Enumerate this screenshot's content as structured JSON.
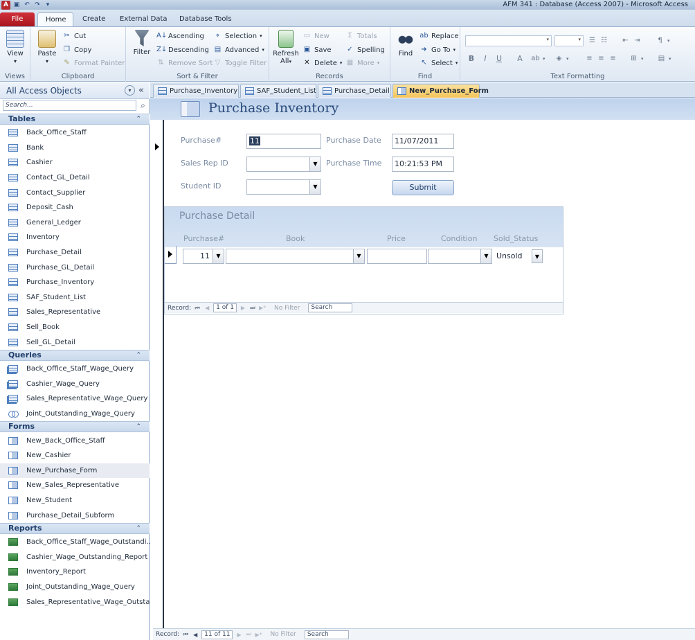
{
  "window": {
    "title": "AFM 341 : Database (Access 2007)  -  Microsoft Access",
    "app_logo": "A"
  },
  "quick_access": [
    "save-icon",
    "undo-icon",
    "redo-icon",
    "customize-icon"
  ],
  "ribbon": {
    "tabs": [
      "File",
      "Home",
      "Create",
      "External Data",
      "Database Tools"
    ],
    "active_tab": "Home",
    "groups": {
      "views": {
        "label": "Views",
        "view": "View"
      },
      "clipboard": {
        "label": "Clipboard",
        "paste": "Paste",
        "cut": "Cut",
        "copy": "Copy",
        "format_painter": "Format Painter"
      },
      "sort_filter": {
        "label": "Sort & Filter",
        "filter": "Filter",
        "ascending": "Ascending",
        "descending": "Descending",
        "remove_sort": "Remove Sort",
        "selection": "Selection",
        "advanced": "Advanced",
        "toggle_filter": "Toggle Filter"
      },
      "records": {
        "label": "Records",
        "refresh": "Refresh",
        "refresh2": "All",
        "new": "New",
        "save": "Save",
        "delete": "Delete",
        "totals": "Totals",
        "spelling": "Spelling",
        "more": "More"
      },
      "find": {
        "label": "Find",
        "find": "Find",
        "replace": "Replace",
        "goto": "Go To",
        "select": "Select"
      },
      "text_formatting": {
        "label": "Text Formatting",
        "bold": "B",
        "italic": "I",
        "underline": "U",
        "font_color": "A"
      }
    }
  },
  "nav": {
    "title": "All Access Objects",
    "search_placeholder": "Search...",
    "sections": [
      {
        "name": "Tables",
        "type": "table",
        "items": [
          "Back_Office_Staff",
          "Bank",
          "Cashier",
          "Contact_GL_Detail",
          "Contact_Supplier",
          "Deposit_Cash",
          "General_Ledger",
          "Inventory",
          "Purchase_Detail",
          "Purchase_GL_Detail",
          "Purchase_Inventory",
          "SAF_Student_List",
          "Sales_Representative",
          "Sell_Book",
          "Sell_GL_Detail"
        ]
      },
      {
        "name": "Queries",
        "type": "query",
        "items": [
          "Back_Office_Staff_Wage_Query",
          "Cashier_Wage_Query",
          "Sales_Representative_Wage_Query",
          "Joint_Outstanding_Wage_Query"
        ]
      },
      {
        "name": "Forms",
        "type": "form",
        "items": [
          "New_Back_Office_Staff",
          "New_Cashier",
          "New_Purchase_Form",
          "New_Sales_Representative",
          "New_Student",
          "Purchase_Detail_Subform"
        ],
        "selected": "New_Purchase_Form"
      },
      {
        "name": "Reports",
        "type": "report",
        "items": [
          "Back_Office_Staff_Wage_Outstandi...",
          "Cashier_Wage_Outstanding_Report",
          "Inventory_Report",
          "Joint_Outstanding_Wage_Query",
          "Sales_Representative_Wage_Outsta..."
        ]
      }
    ]
  },
  "doc_tabs": [
    {
      "label": "Purchase_Inventory",
      "type": "table"
    },
    {
      "label": "SAF_Student_List",
      "type": "table"
    },
    {
      "label": "Purchase_Detail",
      "type": "table"
    },
    {
      "label": "New_Purchase_Form",
      "type": "form",
      "active": true
    }
  ],
  "form": {
    "title": "Purchase Inventory",
    "labels": {
      "purchase_no": "Purchase#",
      "sales_rep": "Sales Rep ID",
      "student_id": "Student ID",
      "purchase_date": "Purchase Date",
      "purchase_time": "Purchase Time"
    },
    "values": {
      "purchase_no": "11",
      "sales_rep": "",
      "student_id": "",
      "purchase_date": "11/07/2011",
      "purchase_time": "10:21:53 PM"
    },
    "submit": "Submit",
    "subform": {
      "title": "Purchase Detail",
      "columns": [
        "Purchase#",
        "Book",
        "Price",
        "Condition",
        "Sold_Status"
      ],
      "row": {
        "purchase_no": "11",
        "book": "",
        "price": "",
        "condition": "",
        "sold_status": "Unsold"
      },
      "record_label": "Record:",
      "record_pos": "1 of 1",
      "no_filter": "No Filter",
      "search": "Search"
    },
    "record_label": "Record:",
    "record_pos": "11 of 11",
    "no_filter": "No Filter",
    "search": "Search"
  }
}
